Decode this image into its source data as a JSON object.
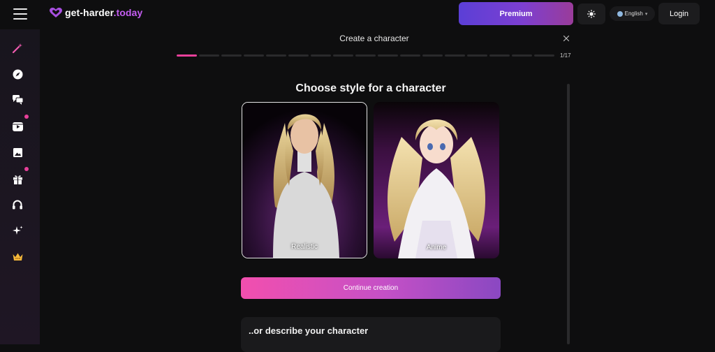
{
  "header": {
    "logo_text": "get-harder",
    "logo_suffix": ".today",
    "premium_label": "Premium",
    "language_label": "English",
    "login_label": "Login"
  },
  "sidebar": {
    "items": [
      {
        "icon": "magic-wand-icon",
        "badge": false,
        "active": true
      },
      {
        "icon": "compass-icon",
        "badge": false
      },
      {
        "icon": "chat-icon",
        "badge": false
      },
      {
        "icon": "video-icon",
        "badge": true
      },
      {
        "icon": "image-icon",
        "badge": false
      },
      {
        "icon": "gift-icon",
        "badge": true
      },
      {
        "icon": "headphones-icon",
        "badge": false
      },
      {
        "icon": "sparkles-icon",
        "badge": false
      },
      {
        "icon": "crown-icon",
        "badge": false
      }
    ]
  },
  "modal": {
    "title": "Create a character",
    "progress": {
      "current": 1,
      "total": 17,
      "label": "1/17"
    },
    "heading": "Choose style for a character",
    "styles": [
      {
        "label": "Realistic",
        "selected": true
      },
      {
        "label": "Anime",
        "selected": false
      }
    ],
    "continue_label": "Continue creation",
    "describe_label": "..or describe your character"
  },
  "colors": {
    "accent_pink": "#e8409a",
    "accent_purple": "#c45df2",
    "background": "#0e0e0f"
  }
}
